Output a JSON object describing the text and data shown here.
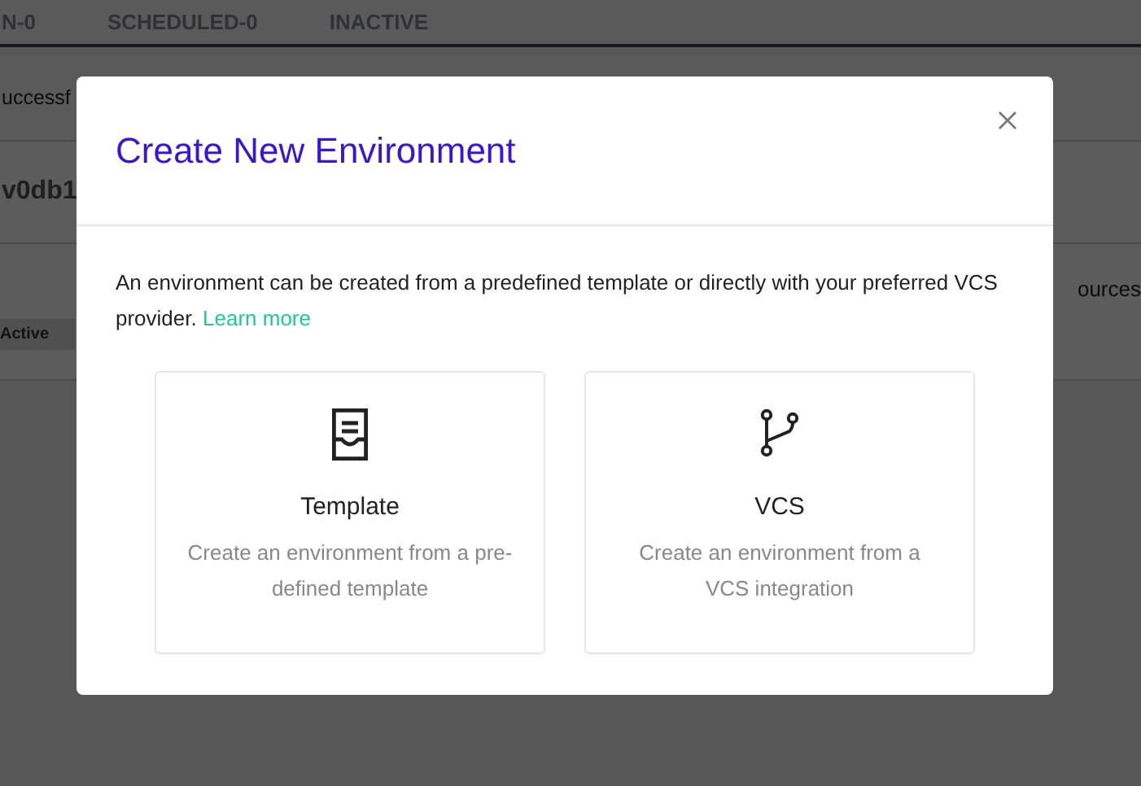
{
  "background": {
    "tabs": [
      {
        "label": "N-0",
        "selected": false
      },
      {
        "label": "SCHEDULED-0",
        "selected": false
      },
      {
        "label": "INACTIVE",
        "selected": false
      }
    ],
    "rows": [
      {
        "left": "uccessf",
        "right": ""
      },
      {
        "left": "v0db1",
        "right": ""
      },
      {
        "left": "",
        "right": "ources",
        "badge": "Active"
      }
    ]
  },
  "modal": {
    "title": "Create New Environment",
    "description": "An environment can be created from a predefined template or directly with your preferred VCS provider.",
    "link": "Learn more",
    "options": [
      {
        "kind": "template",
        "title": "Template",
        "description": "Create an environment from a pre-defined template"
      },
      {
        "kind": "vcs",
        "title": "VCS",
        "description": "Create an environment from a VCS integration"
      }
    ]
  }
}
